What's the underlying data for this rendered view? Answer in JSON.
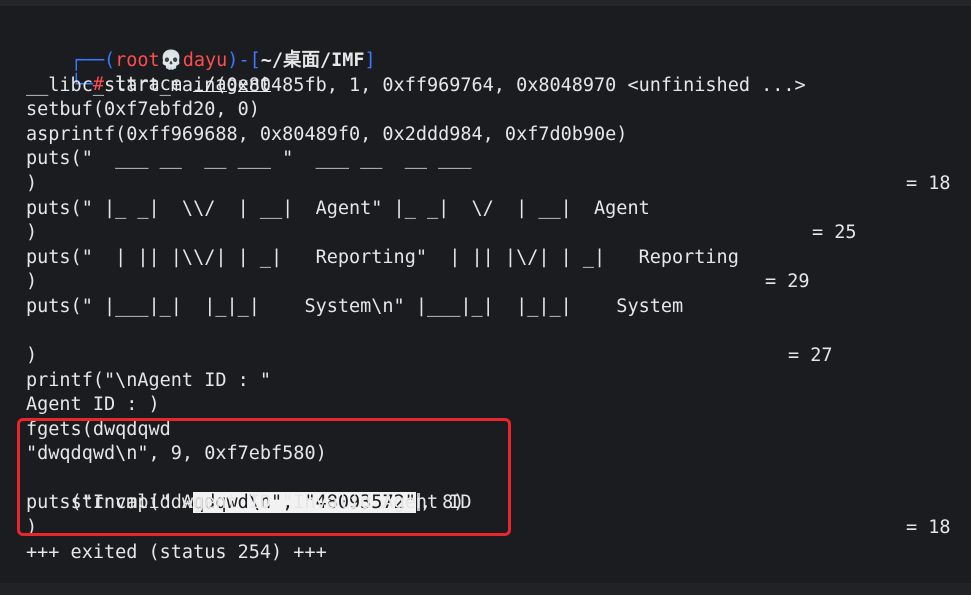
{
  "prompt": {
    "corner": "┌──",
    "open": "(",
    "user": "root",
    "skull": "💀",
    "host": "dayu",
    "close": ")",
    "dash": "-",
    "path_open": "[",
    "path": "~/桌面/IMF",
    "path_close": "]",
    "corner2": "└─",
    "hash": "#",
    "command": "ltrace",
    "arg": "./agent"
  },
  "lines": {
    "l1": "__libc_start_main(0x80485fb, 1, 0xff969764, 0x8048970 <unfinished ...>",
    "l2": "setbuf(0xf7ebfd20, 0)",
    "l3": "asprintf(0xff969688, 0x80489f0, 0x2ddd984, 0xf7d0b90e)",
    "l4": "puts(\"  ___ __  __ ___ \"  ___ __  __ ___",
    "l5": ")",
    "l5r": "= 18",
    "l6": "puts(\" |_ _|  \\\\/  | __|  Agent\" |_ _|  \\/  | __|  Agent",
    "l7": ")",
    "l7r": "= 25",
    "l8": "puts(\"  | || |\\\\/| | _|   Reporting\"  | || |\\/| | _|   Reporting",
    "l9": ")",
    "l9r": "= 29",
    "l10": "puts(\" |___|_|  |_|_|    System\\n\" |___|_|  |_|_|    System",
    "l12": ")",
    "l12r": "= 27",
    "l13": "printf(\"\\nAgent ID : \"",
    "l14": "Agent ID : )",
    "l15": "fgets(dwqdqwd",
    "l16": "\"dwqdqwd\\n\", 9, 0xf7ebf580)",
    "l17a": "strncmp(\"dw",
    "l17sel": "qdqwd\\n\", \"48093572\"",
    "l17b": ", 8)",
    "l18": "puts(\"Invalid Agent ID \"Invalid Agent ID",
    "l19": ")",
    "l19r": "= 18",
    "l20": "+++ exited (status 254) +++"
  },
  "colors": {
    "background": "#1b1c20",
    "prompt_frame": "#3b78ff",
    "user_host": "#ff4d4d",
    "highlight_box": "#e8262b"
  }
}
